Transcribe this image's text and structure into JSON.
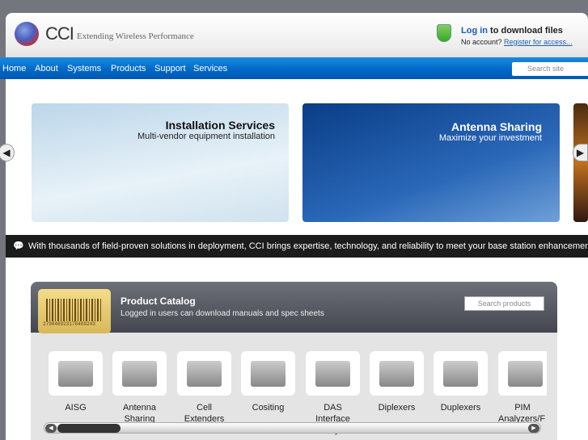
{
  "header": {
    "logo_text": "CCI",
    "tagline": "Extending Wireless Performance",
    "login_link": "Log in",
    "login_rest": " to download files",
    "no_account": "No account? ",
    "register_link": "Register for access..."
  },
  "nav": {
    "items": [
      "Home",
      "About",
      "Systems",
      "Products",
      "Support",
      "Services"
    ],
    "search_placeholder": "Search site"
  },
  "banners": [
    {
      "title": "Installation Services",
      "subtitle": "Multi-vendor equipment installation"
    },
    {
      "title": "Antenna Sharing",
      "subtitle": "Maximize your investment"
    }
  ],
  "ticker": "With thousands of field-proven solutions in deployment, CCI brings expertise, technology, and reliability to meet your base station enhancement",
  "catalog": {
    "title": "Product Catalog",
    "subtitle": "Logged in users can download manuals and spec sheets",
    "barcode": "279846923178469243",
    "search_placeholder": "Search products",
    "products": [
      {
        "l1": "AISG",
        "l2": ""
      },
      {
        "l1": "Antenna",
        "l2": "Sharing"
      },
      {
        "l1": "Cell",
        "l2": "Extenders"
      },
      {
        "l1": "Cositing",
        "l2": ""
      },
      {
        "l1": "DAS Interface",
        "l2": "Trays"
      },
      {
        "l1": "Diplexers",
        "l2": ""
      },
      {
        "l1": "Duplexers",
        "l2": ""
      },
      {
        "l1": "PIM",
        "l2": "Analyzers/F"
      }
    ]
  }
}
